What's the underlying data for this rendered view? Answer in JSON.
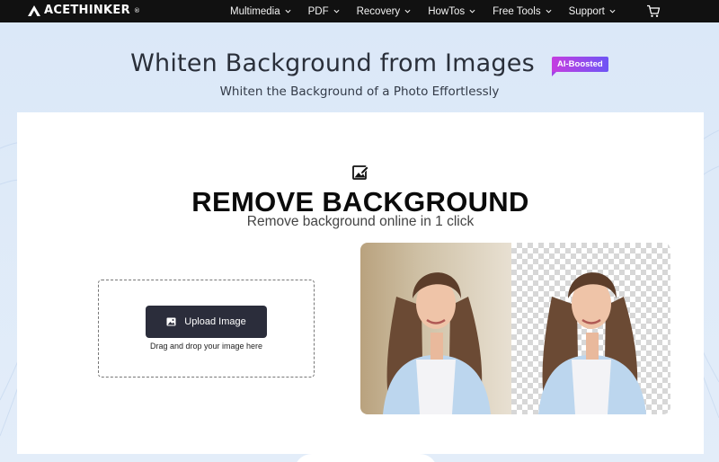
{
  "brand": {
    "name": "ACETHINKER",
    "reg": "®"
  },
  "nav": {
    "items": [
      {
        "label": "Multimedia"
      },
      {
        "label": "PDF"
      },
      {
        "label": "Recovery"
      },
      {
        "label": "HowTos"
      },
      {
        "label": "Free Tools"
      },
      {
        "label": "Support"
      }
    ]
  },
  "hero": {
    "title": "Whiten Background from Images",
    "badge": "AI-Boosted",
    "subtitle": "Whiten the Background of a Photo Effortlessly"
  },
  "tool": {
    "heading": "REMOVE BACKGROUND",
    "subheading": "Remove background online in 1 click",
    "upload_label": "Upload Image",
    "drop_hint": "Drag and drop your image here"
  },
  "colors": {
    "nav_bg": "#111111",
    "hero_bg": "#dde9f7",
    "button_bg": "#2b2d3b",
    "badge_from": "#c53de0",
    "badge_to": "#6e55f5"
  },
  "icons": [
    "logo-mark-icon",
    "chevron-down-icon",
    "cart-icon",
    "image-edit-icon",
    "image-icon"
  ]
}
